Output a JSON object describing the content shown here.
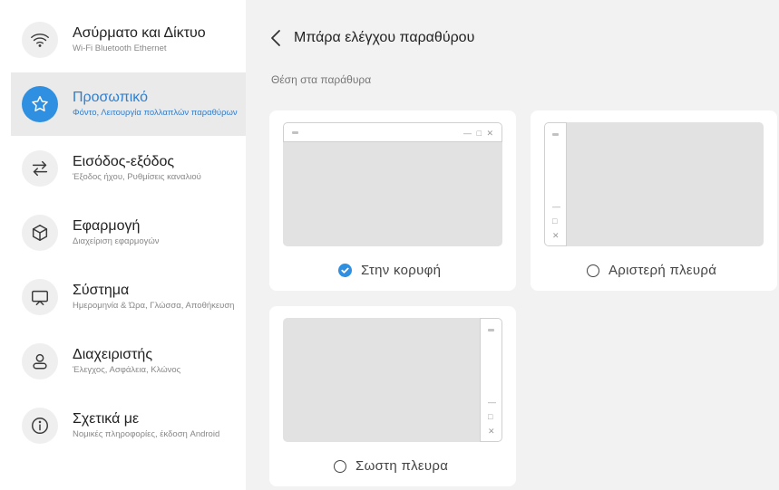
{
  "sidebar": {
    "items": [
      {
        "title": "Ασύρματο και Δίκτυο",
        "subtitle": "Wi-Fi Bluetooth Ethernet",
        "icon": "wifi-icon"
      },
      {
        "title": "Προσωπικό",
        "subtitle": "Φόντο, Λειτουργία πολλαπλών παραθύρων",
        "icon": "star-icon",
        "active": true
      },
      {
        "title": "Εισόδος-εξόδος",
        "subtitle": "Έξοδος ήχου, Ρυθμίσεις καναλιού",
        "icon": "swap-arrows-icon"
      },
      {
        "title": "Εφαρμογή",
        "subtitle": "Διαχείριση εφαρμογών",
        "icon": "cube-icon"
      },
      {
        "title": "Σύστημα",
        "subtitle": "Ημερομηνία & Ώρα, Γλώσσα, Αποθήκευση",
        "icon": "monitor-icon"
      },
      {
        "title": "Διαχειριστής",
        "subtitle": "Έλεγχος, Ασφάλεια, Κλώνος",
        "icon": "user-icon"
      },
      {
        "title": "Σχετικά με",
        "subtitle": "Νομικές πληροφορίες, έκδοση Android",
        "icon": "info-icon"
      }
    ]
  },
  "header": {
    "title": "Μπάρα ελέγχου παραθύρου"
  },
  "section": {
    "label": "Θέση στα παράθυρα"
  },
  "options": [
    {
      "label": "Στην κορυφή",
      "selected": true
    },
    {
      "label": "Αριστερή πλευρά",
      "selected": false
    },
    {
      "label": "Σωστη πλευρα",
      "selected": false
    }
  ],
  "window_controls": {
    "minimize": "—",
    "maximize": "□",
    "close": "✕"
  },
  "colors": {
    "accent": "#2f8fe0",
    "background": "#f2f2f2",
    "card": "#ffffff"
  }
}
